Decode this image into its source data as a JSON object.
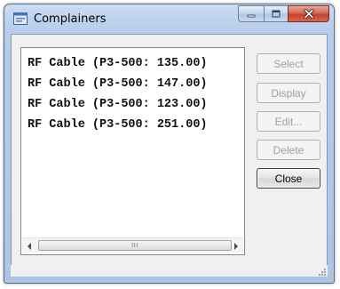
{
  "window": {
    "title": "Complainers",
    "icon": "application-icon",
    "caption_buttons": [
      "minimize-icon",
      "maximize-icon",
      "close-icon"
    ]
  },
  "list": {
    "items": [
      "RF Cable (P3-500: 135.00)",
      "RF Cable (P3-500: 147.00)",
      "RF Cable (P3-500: 123.00)",
      "RF Cable (P3-500: 251.00)"
    ]
  },
  "buttons": {
    "select": "Select",
    "display": "Display",
    "edit": "Edit...",
    "delete": "Delete",
    "close": "Close"
  },
  "scrollbar": {
    "thumb_grip": "III"
  },
  "colors": {
    "title_bar": "#b6cde9",
    "close_button": "#c2432c",
    "client_background": "#f0f0f0"
  }
}
